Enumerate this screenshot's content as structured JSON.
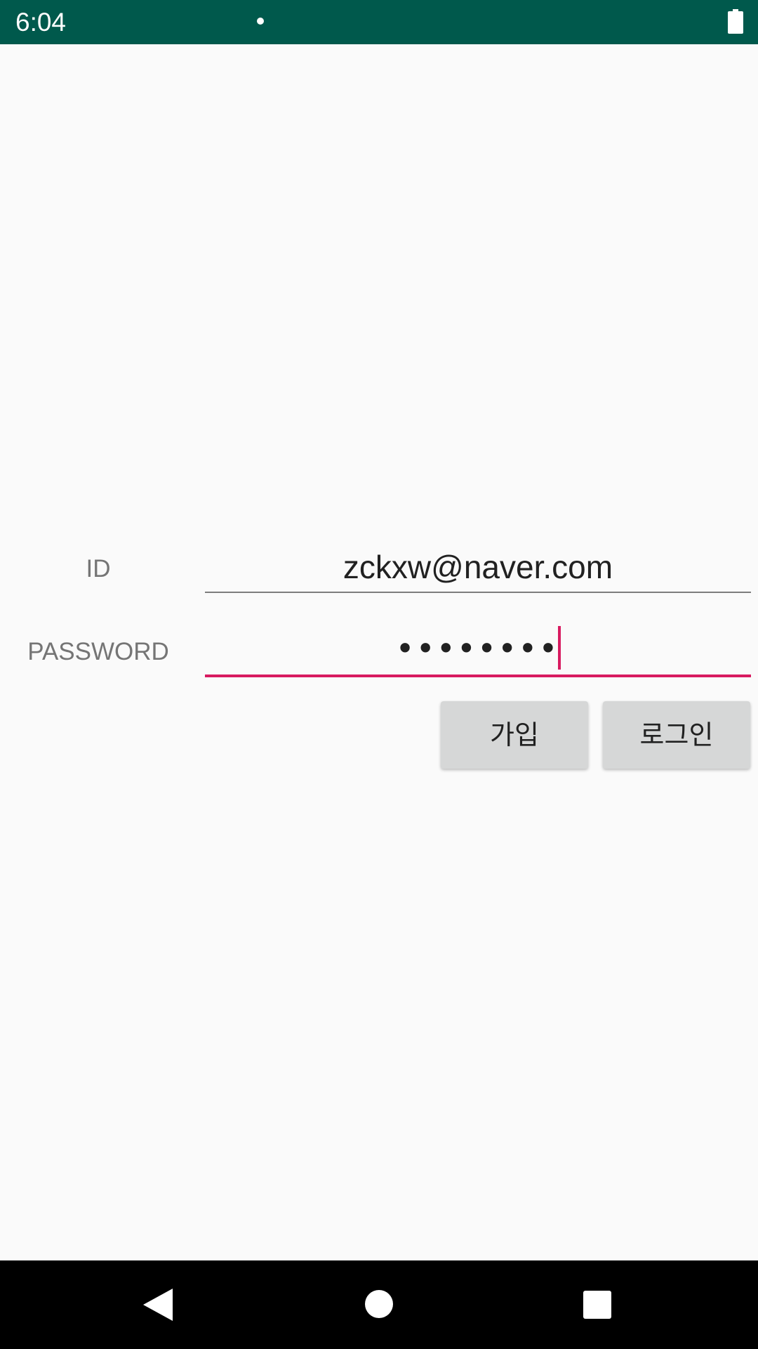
{
  "status_bar": {
    "time": "6:04",
    "background_color": "#00594c"
  },
  "form": {
    "id_label": "ID",
    "id_value": "zckxw@naver.com",
    "password_label": "PASSWORD",
    "password_value": "••••••••",
    "accent_color": "#d81b60"
  },
  "buttons": {
    "join_label": "가입",
    "login_label": "로그인"
  },
  "nav_bar": {
    "back_icon": "triangle-back-icon",
    "home_icon": "circle-home-icon",
    "recents_icon": "square-recents-icon"
  }
}
